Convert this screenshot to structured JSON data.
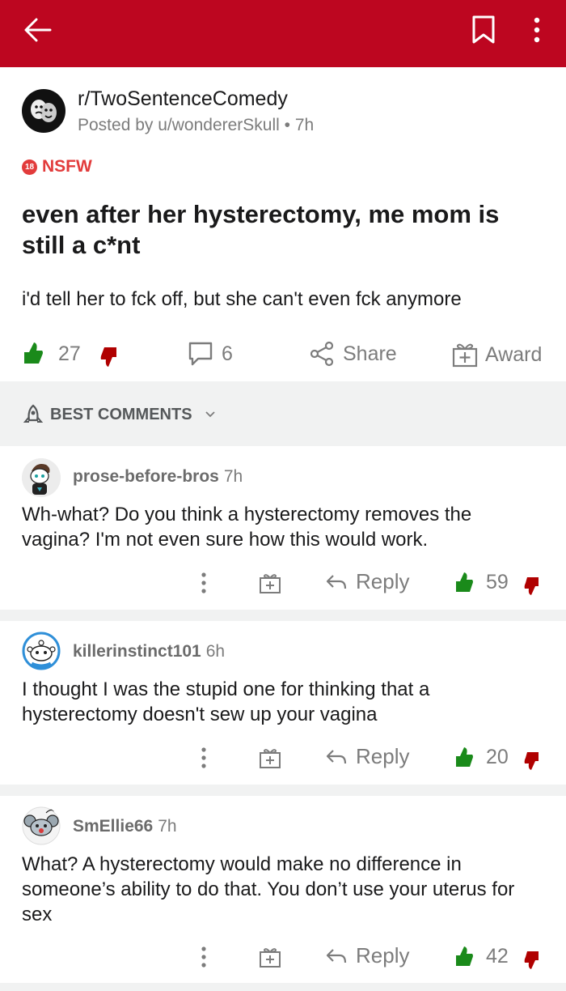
{
  "topbar": {
    "back_icon": "arrow-left-icon",
    "bookmark_icon": "bookmark-icon",
    "more_icon": "more-vertical-icon",
    "color": "#bd0620"
  },
  "post": {
    "subreddit": "r/TwoSentenceComedy",
    "posted_by": "Posted by u/wondererSkull • 7h",
    "nsfw_badge": "18",
    "nsfw_label": "NSFW",
    "title": "even after her hysterectomy, me mom is still a c*nt",
    "body": "i'd tell her to fck off, but she can't even fck anymore",
    "score": "27",
    "comments": "6",
    "share_label": "Share",
    "award_label": "Award"
  },
  "sort": {
    "label": "BEST COMMENTS"
  },
  "comments": [
    {
      "user": "prose-before-bros",
      "time": "7h",
      "text": "Wh-what? Do you think a hysterectomy removes the vagina? I'm not even sure how this would work.",
      "reply_label": "Reply",
      "score": "59"
    },
    {
      "user": "killerinstinct101",
      "time": "6h",
      "text": "I thought I was the stupid one for thinking that a hysterectomy doesn't sew up your vagina",
      "reply_label": "Reply",
      "score": "20"
    },
    {
      "user": "SmEllie66",
      "time": "7h",
      "text": "What? A hysterectomy would make no difference in someone’s ability to do that. You don’t use your uterus for sex",
      "reply_label": "Reply",
      "score": "42"
    }
  ],
  "colors": {
    "upvote": "#1a8a1a",
    "downvote": "#b00000",
    "nsfw": "#e23b3b",
    "muted": "#7c7c7c"
  }
}
